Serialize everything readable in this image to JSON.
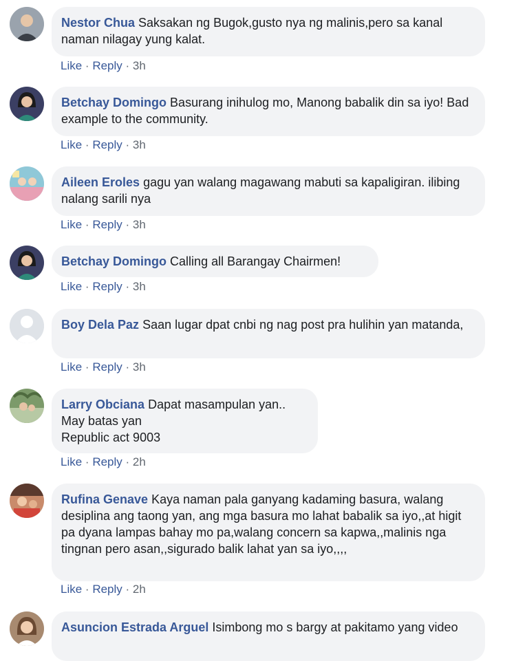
{
  "comments": [
    {
      "author": "Nestor Chua",
      "text": "Saksakan ng Bugok,gusto nya ng malinis,pero sa kanal naman nilagay yung kalat.",
      "like": "Like",
      "reply": "Reply",
      "time": "3h",
      "avatar_icon": "man-avatar-icon",
      "avatar_bg": "#9aa3ad"
    },
    {
      "author": "Betchay Domingo",
      "text": "Basurang inihulog mo, Manong babalik din sa iyo! Bad example to the community.",
      "like": "Like",
      "reply": "Reply",
      "time": "3h",
      "avatar_icon": "woman-avatar-icon",
      "avatar_bg": "#3b3f63"
    },
    {
      "author": "Aileen Eroles",
      "text": "gagu yan walang magawang mabuti sa kapaligiran. ilibing nalang sarili nya",
      "like": "Like",
      "reply": "Reply",
      "time": "3h",
      "avatar_icon": "photo-avatar-icon",
      "avatar_bg": "#8fc8d8"
    },
    {
      "author": "Betchay Domingo",
      "text": "Calling all Barangay Chairmen!",
      "like": "Like",
      "reply": "Reply",
      "time": "3h",
      "avatar_icon": "woman-avatar-icon",
      "avatar_bg": "#3b3f63"
    },
    {
      "author": "Boy Dela Paz",
      "text": "Saan lugar dpat cnbi ng nag post pra hulihin yan matanda,",
      "like": "Like",
      "reply": "Reply",
      "time": "3h",
      "avatar_icon": "default-avatar-icon",
      "avatar_bg": "#dfe3e8"
    },
    {
      "author": "Larry Obciana",
      "text": "Dapat masampulan yan..",
      "text_lines": [
        "May batas yan",
        "Republic act 9003"
      ],
      "like": "Like",
      "reply": "Reply",
      "time": "2h",
      "avatar_icon": "photo-avatar-icon",
      "avatar_bg": "#7c9a6a"
    },
    {
      "author": "Rufina Genave",
      "text": "Kaya naman pala ganyang kadaming basura, walang desiplina ang taong yan, ang mga basura mo lahat babalik sa iyo,,at higit pa dyana lampas bahay mo pa,walang concern sa kapwa,,malinis nga tingnan pero asan,,sigurado balik lahat yan sa iyo,,,,",
      "like": "Like",
      "reply": "Reply",
      "time": "2h",
      "avatar_icon": "photo-avatar-icon",
      "avatar_bg": "#c98b6b"
    },
    {
      "author": "Asuncion Estrada Arguel",
      "text": "Isimbong mo s bargy at pakitamo yang video",
      "avatar_icon": "woman-avatar-icon",
      "avatar_bg": "#a88a70"
    }
  ]
}
